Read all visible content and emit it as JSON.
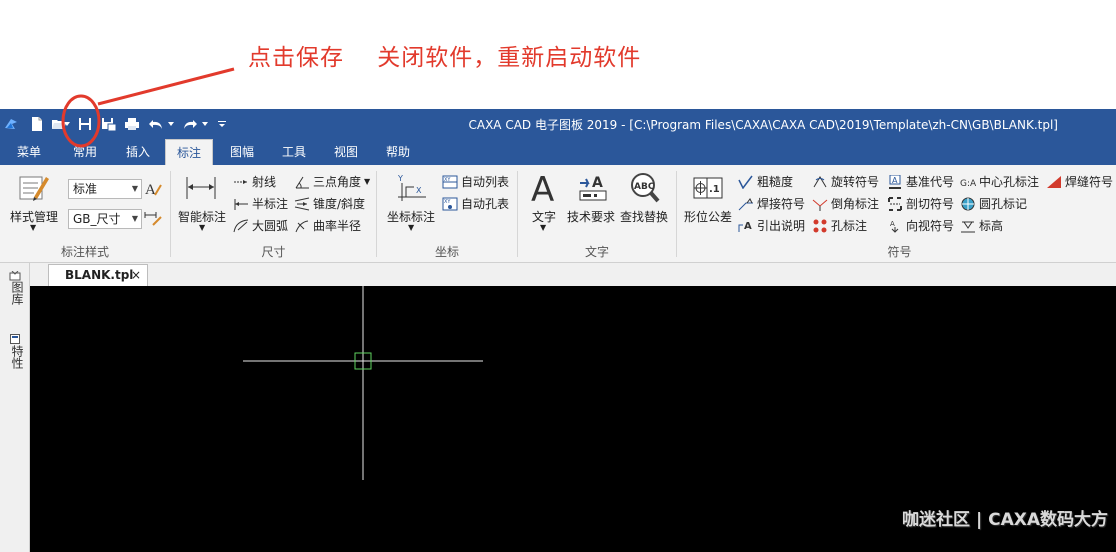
{
  "annotation": {
    "text": "点击保存    关闭软件，重新启动软件",
    "color": "#e23a2c"
  },
  "window": {
    "title": "CAXA CAD 电子图板 2019 - [C:\\Program Files\\CAXA\\CAXA CAD\\2019\\Template\\zh-CN\\GB\\BLANK.tpl]"
  },
  "tabs": [
    {
      "label": "菜单"
    },
    {
      "label": "常用"
    },
    {
      "label": "插入"
    },
    {
      "label": "标注",
      "active": true
    },
    {
      "label": "图幅"
    },
    {
      "label": "工具"
    },
    {
      "label": "视图"
    },
    {
      "label": "帮助"
    }
  ],
  "ribbon": {
    "style_group": {
      "label": "标注样式",
      "style_manage": "样式管理",
      "combo1": "标准",
      "combo2": "GB_尺寸"
    },
    "dimension_group": {
      "label": "尺寸",
      "smart": "智能标注",
      "items": [
        "射线",
        "三点角度",
        "半标注",
        "锥度/斜度",
        "大圆弧",
        "曲率半径"
      ]
    },
    "coord_group": {
      "label": "坐标",
      "main": "坐标标注",
      "items": [
        "自动列表",
        "自动孔表"
      ]
    },
    "text_group": {
      "label": "文字",
      "text": "文字",
      "tech": "技术要求",
      "find": "查找替换"
    },
    "symbol_group": {
      "label": "符号",
      "main": "形位公差",
      "items": [
        "粗糙度",
        "旋转符号",
        "基准代号",
        "中心孔标注",
        "焊缝符号",
        "焊接符号",
        "倒角标注",
        "剖切符号",
        "圆孔标记",
        "引出说明",
        "孔标注",
        "向视符号",
        "标高"
      ]
    }
  },
  "document": {
    "tab_label": "BLANK.tpl",
    "close": "×"
  },
  "side_panel": {
    "items": [
      "图库",
      "特性"
    ]
  },
  "watermark": "咖迷社区 | CAXA数码大方",
  "colors": {
    "titlebar": "#2b579a",
    "ribbon": "#f3f3f3",
    "canvas": "#000000",
    "crosshair": "#e8e8e8",
    "pickbox": "#5fd35f"
  }
}
